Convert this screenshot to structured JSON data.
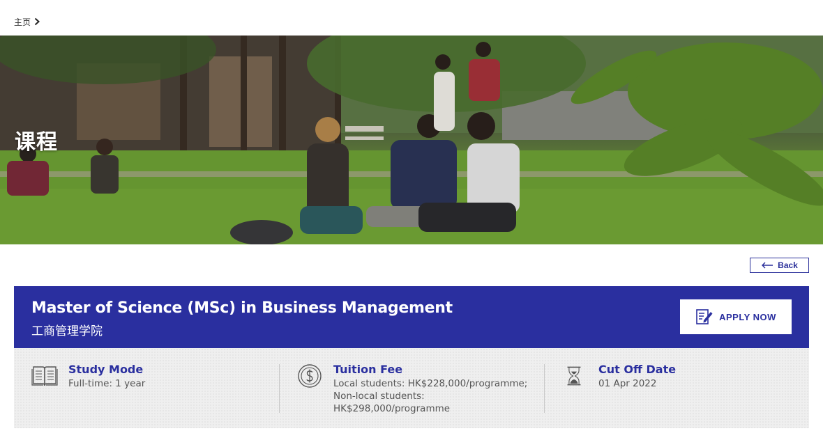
{
  "breadcrumb": {
    "home": "主页"
  },
  "hero": {
    "title": "课程"
  },
  "back": {
    "label": "Back"
  },
  "program": {
    "title": "Master of Science (MSc) in Business Management",
    "school": "工商管理学院",
    "apply_label": "APPLY NOW"
  },
  "info": {
    "study_mode": {
      "label": "Study Mode",
      "value": "Full-time: 1 year"
    },
    "tuition": {
      "label": "Tuition Fee",
      "lines": [
        "Local students: HK$228,000/programme;",
        "Non-local students:",
        "HK$298,000/programme"
      ]
    },
    "cutoff": {
      "label": "Cut Off Date",
      "value": "01 Apr 2022"
    }
  },
  "icons": {
    "breadcrumb": "chevron-right-icon",
    "back": "arrow-left-icon",
    "apply": "edit-document-icon",
    "study_mode": "open-book-icon",
    "tuition": "dollar-coin-icon",
    "cutoff": "hourglass-icon"
  },
  "colors": {
    "brand_blue": "#2a2f9f",
    "panel_bg": "#efefef"
  }
}
